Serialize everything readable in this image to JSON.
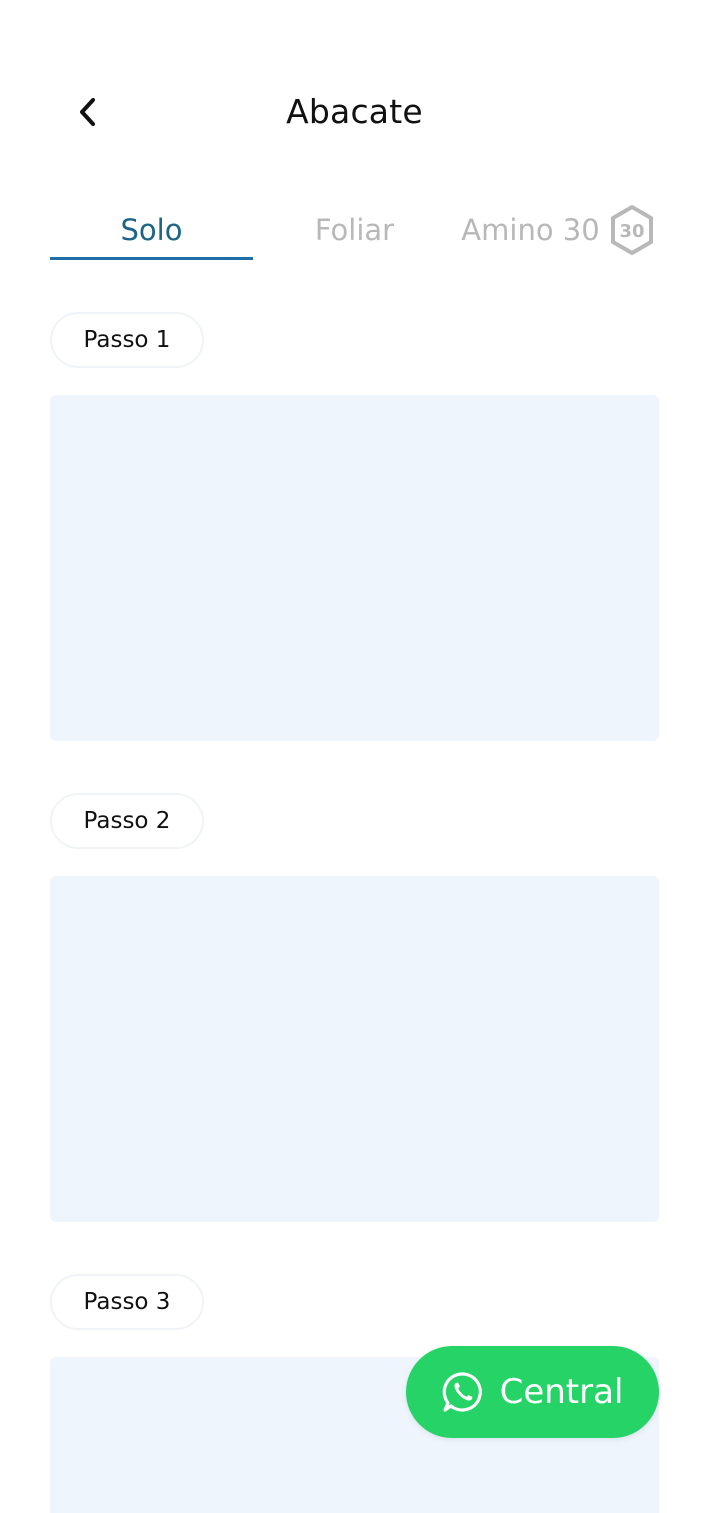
{
  "header": {
    "title": "Abacate",
    "back_icon": "chevron-left-icon"
  },
  "tabs": [
    {
      "label": "Solo",
      "active": true
    },
    {
      "label": "Foliar",
      "active": false
    },
    {
      "label": "Amino 30",
      "active": false,
      "badge_text": "30"
    }
  ],
  "steps": [
    {
      "label": "Passo 1"
    },
    {
      "label": "Passo 2"
    },
    {
      "label": "Passo 3"
    }
  ],
  "fab": {
    "label": "Central",
    "icon": "whatsapp-icon",
    "color": "#25d366"
  },
  "colors": {
    "accent": "#1e6488",
    "tab_inactive": "#b8b8b8",
    "media_placeholder": "#eef5fd"
  }
}
